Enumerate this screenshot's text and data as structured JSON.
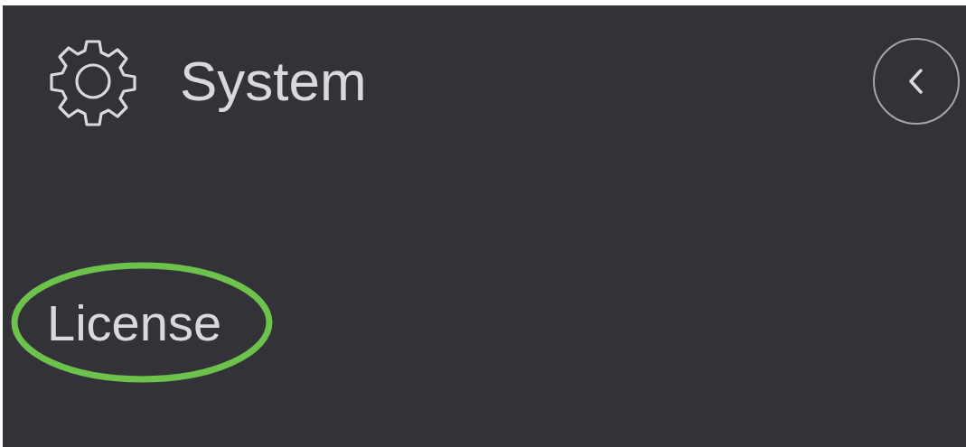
{
  "header": {
    "title": "System"
  },
  "items": [
    {
      "label": "License",
      "highlighted": true
    }
  ]
}
